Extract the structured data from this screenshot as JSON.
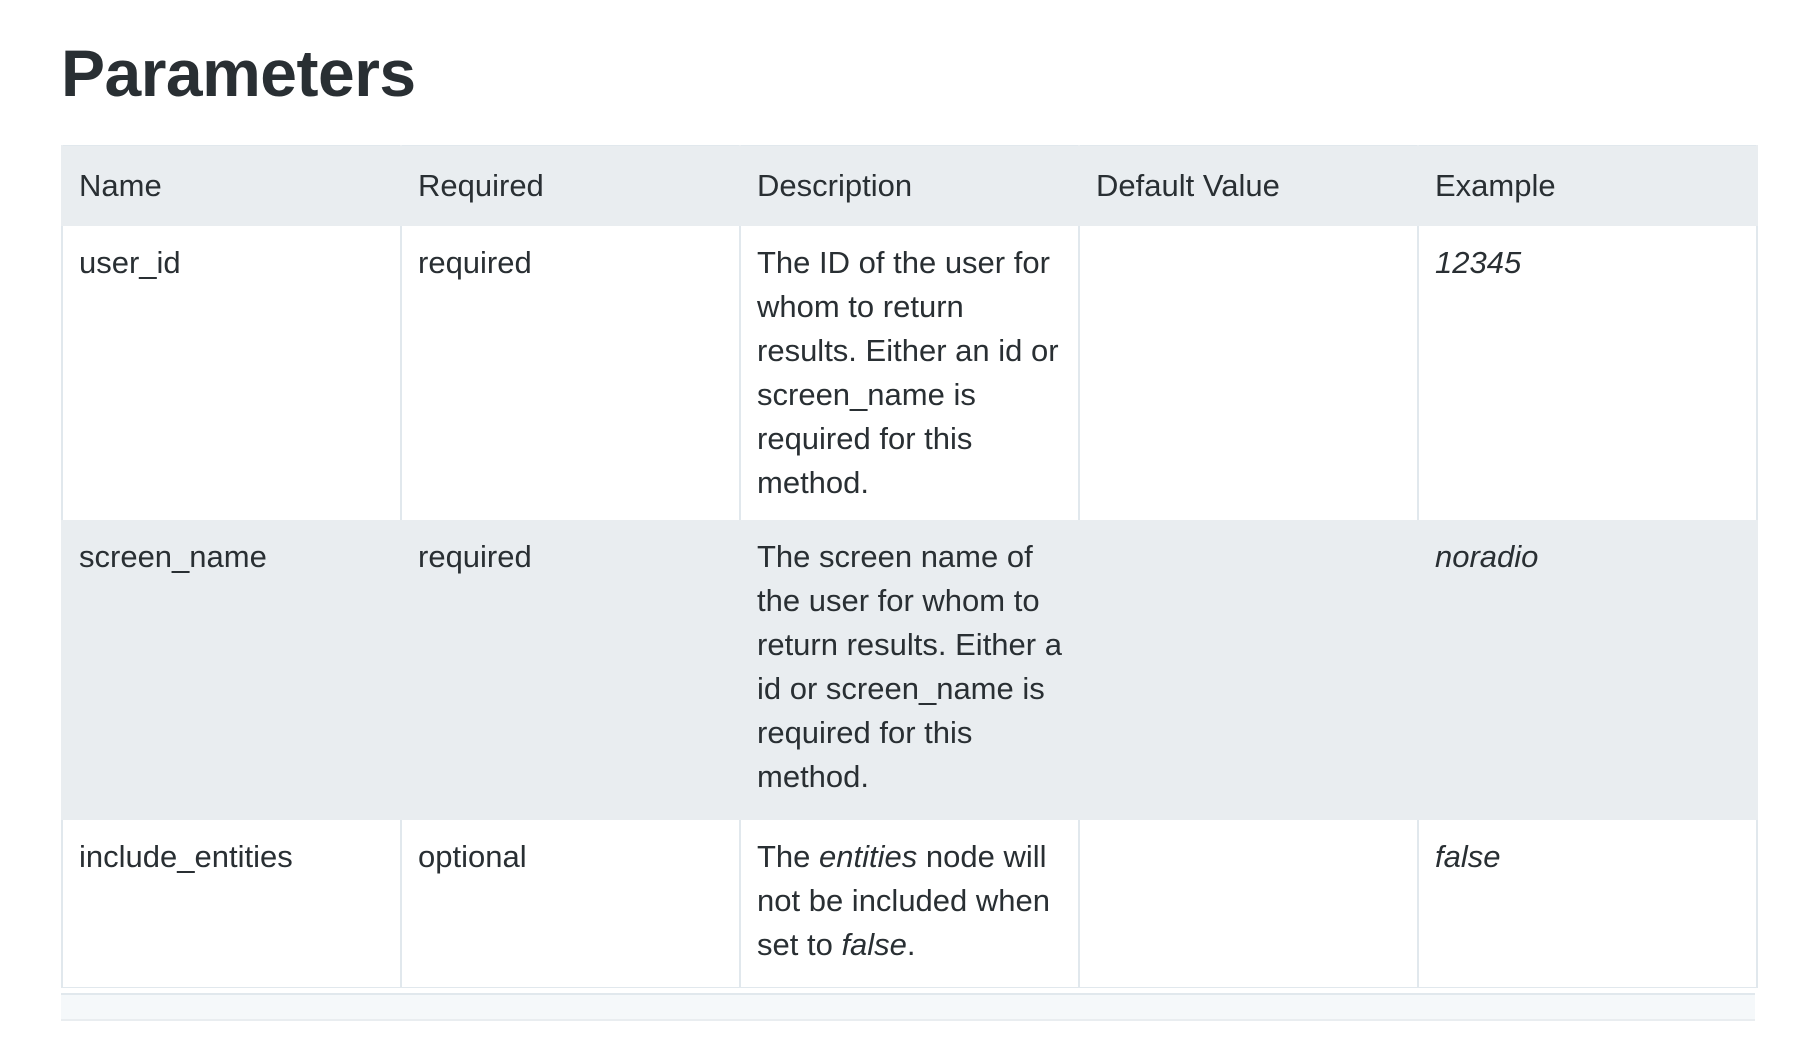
{
  "page": {
    "title": "Parameters"
  },
  "table": {
    "headers": [
      "Name",
      "Required",
      "Description",
      "Default Value",
      "Example"
    ],
    "rows": [
      {
        "name": "user_id",
        "required": "required",
        "description": "The ID of the user for whom to return results. Either an id or screen_name is required for this method.",
        "default": "",
        "example": "12345"
      },
      {
        "name": "screen_name",
        "required": "required",
        "description": "The screen name of the user for whom to return results. Either a id or screen_name is required for this method.",
        "default": "",
        "example": "noradio"
      },
      {
        "name": "include_entities",
        "required": "optional",
        "description_parts": [
          "The ",
          "entities",
          " node will not be included when set to ",
          "false",
          "."
        ],
        "default": "",
        "example": "false"
      }
    ]
  },
  "colors": {
    "text": "#292f33",
    "header_background": "#e9edf0",
    "shaded_row_background": "#e9edf0",
    "border": "#e1e8ed"
  }
}
